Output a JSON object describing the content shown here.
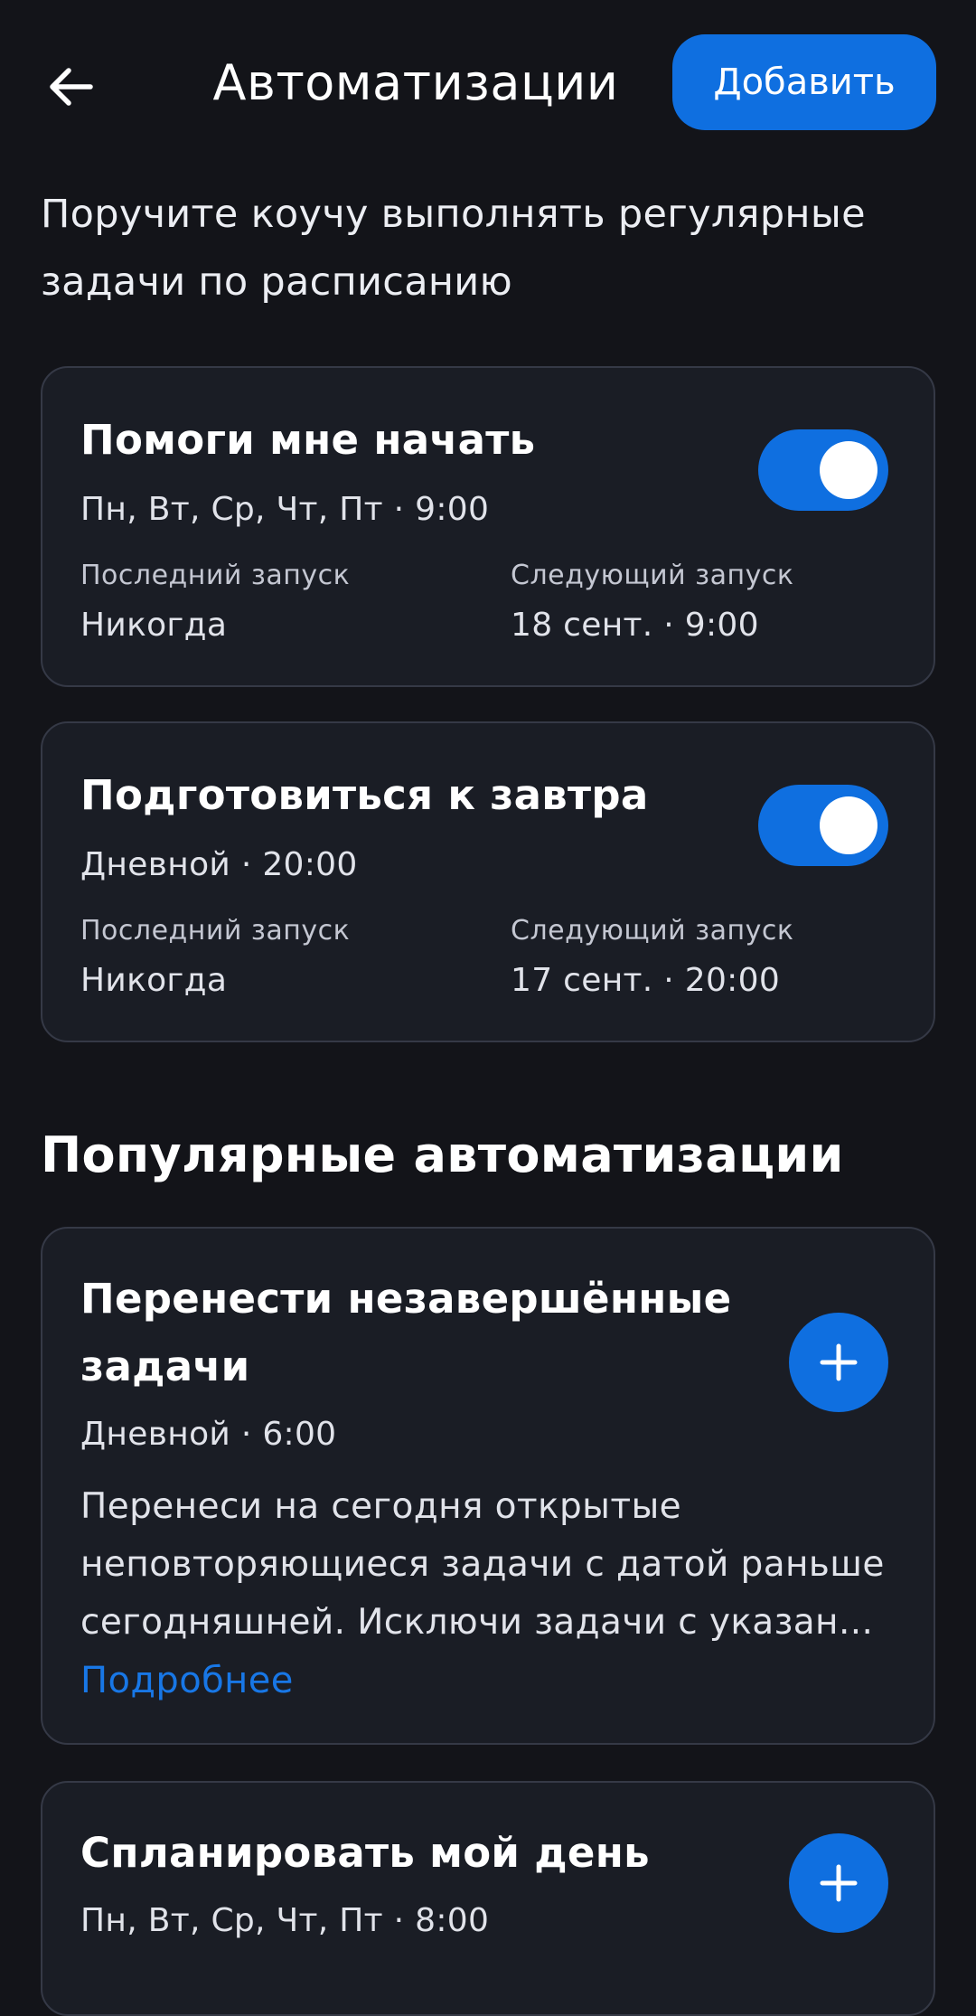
{
  "header": {
    "title": "Автоматизации",
    "add_label": "Добавить"
  },
  "subtitle": {
    "line1": "Поручите коучу выполнять регулярные",
    "line2": "задачи по расписанию"
  },
  "automations": [
    {
      "title": "Помоги мне начать",
      "schedule": "Пн, Вт, Ср, Чт, Пт · 9:00",
      "last_run_label": "Последний запуск",
      "last_run_value": "Никогда",
      "next_run_label": "Следующий запуск",
      "next_run_value": "18 сент. · 9:00",
      "enabled": true
    },
    {
      "title": "Подготовиться к завтра",
      "schedule": "Дневной · 20:00",
      "last_run_label": "Последний запуск",
      "last_run_value": "Никогда",
      "next_run_label": "Следующий запуск",
      "next_run_value": "17 сент. · 20:00",
      "enabled": true
    }
  ],
  "popular": {
    "title": "Популярные автоматизации",
    "items": [
      {
        "title_line1": "Перенести незавершённые",
        "title_line2": "задачи",
        "schedule": "Дневной · 6:00",
        "desc_line1": "Перенеси на сегодня открытые",
        "desc_line2": "неповторяющиеся задачи с датой раньше",
        "desc_line3": "сегодняшней. Исключи задачи с указан...",
        "more_label": "Подробнее"
      },
      {
        "title": "Спланировать мой день",
        "schedule": "Пн, Вт, Ср, Чт, Пт · 8:00"
      }
    ]
  },
  "colors": {
    "background": "#131419",
    "card": "#1a1d25",
    "accent": "#0f6fe0",
    "link": "#1877e6"
  },
  "icons": {
    "back": "arrow-left-icon",
    "add": "plus-icon"
  }
}
